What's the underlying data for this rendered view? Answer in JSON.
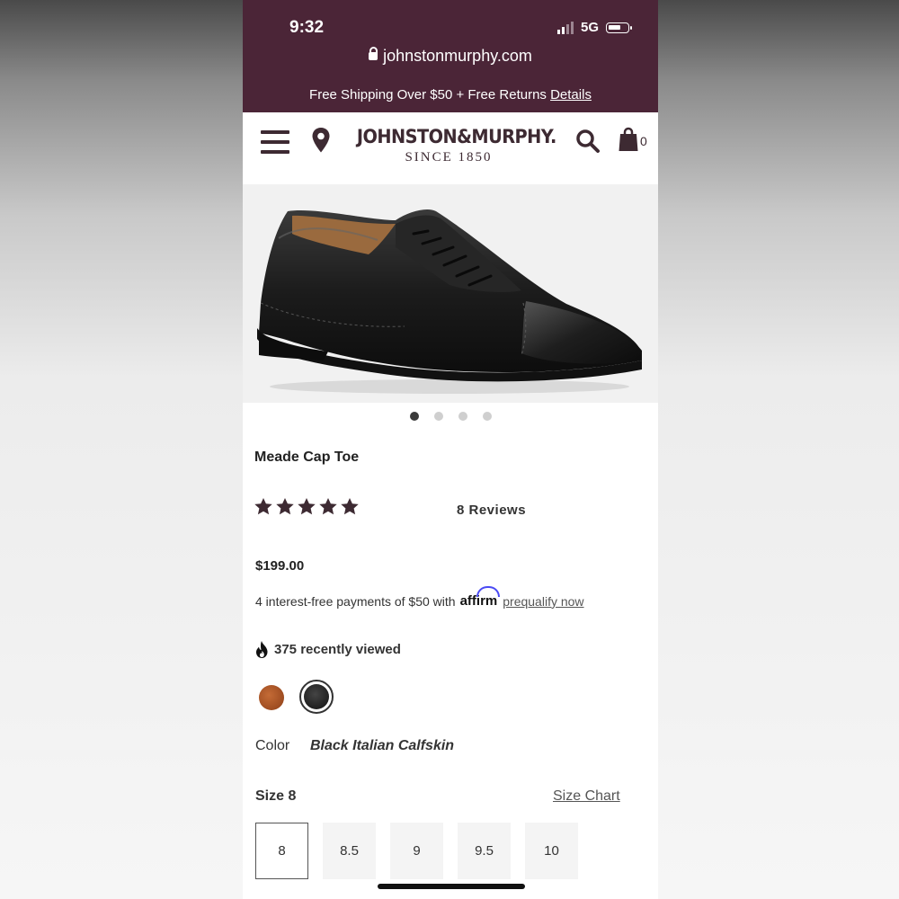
{
  "status_bar": {
    "time": "9:32",
    "network": "5G"
  },
  "browser": {
    "url": "johnstonmurphy.com"
  },
  "promo": {
    "text": "Free Shipping Over $50 + Free Returns",
    "link": "Details"
  },
  "header": {
    "brand_name": "JOHNSTON&MURPHY.",
    "brand_since": "SINCE 1850",
    "cart_count": "0"
  },
  "gallery": {
    "image_count": 4,
    "active_index": 0
  },
  "product": {
    "title": "Meade Cap Toe",
    "rating": 5,
    "reviews": "8 Reviews",
    "price": "$199.00",
    "payments_text": "4 interest-free payments of $50 with",
    "affirm": "affirm",
    "prequalify": "prequalify now",
    "recently_viewed": "375 recently viewed"
  },
  "colors": {
    "label": "Color",
    "selected": "Black Italian Calfskin",
    "swatches": [
      {
        "name": "brown",
        "color": "#a8532a"
      },
      {
        "name": "black",
        "color": "#1a1a1a",
        "selected": true
      }
    ]
  },
  "sizes": {
    "label": "Size 8",
    "chart_link": "Size Chart",
    "options": [
      "8",
      "8.5",
      "9",
      "9.5",
      "10"
    ],
    "selected": "8"
  },
  "theme": {
    "brand_color": "#4b2537",
    "dark_icon_color": "#3d2a32"
  }
}
